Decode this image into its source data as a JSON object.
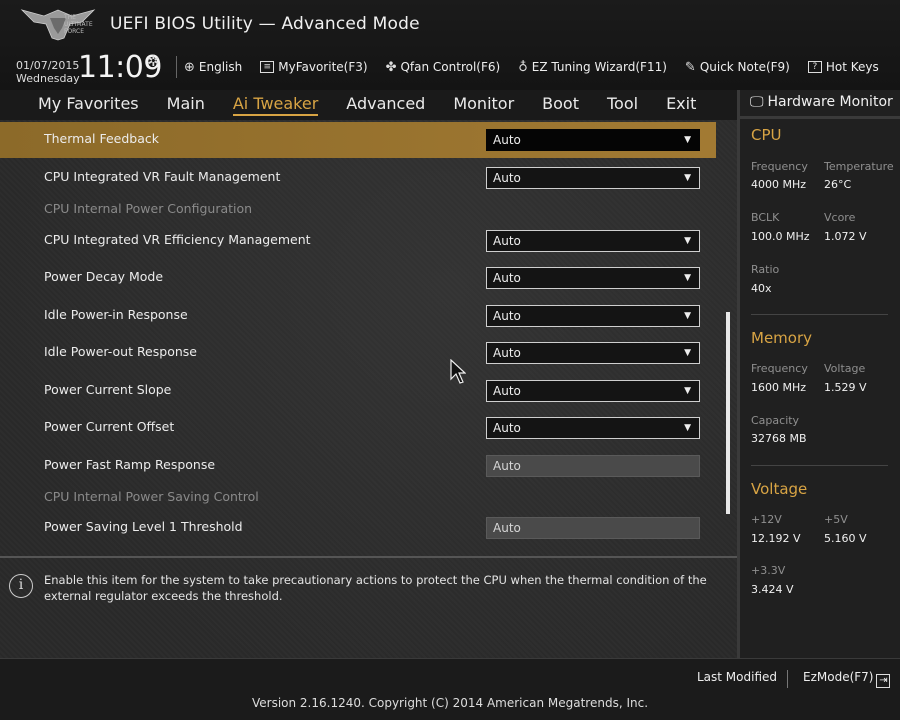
{
  "header": {
    "logo_text": "THE ULTIMATE FORCE",
    "title": "UEFI BIOS Utility — Advanced Mode",
    "date": "01/07/2015",
    "day": "Wednesday",
    "time": "11:09",
    "toolbar": [
      {
        "icon": "globe-icon",
        "label": "English"
      },
      {
        "icon": "myfavorite-icon",
        "label": "MyFavorite(F3)"
      },
      {
        "icon": "fan-icon",
        "label": "Qfan Control(F6)"
      },
      {
        "icon": "lightbulb-icon",
        "label": "EZ Tuning Wizard(F11)"
      },
      {
        "icon": "note-icon",
        "label": "Quick Note(F9)"
      },
      {
        "icon": "question-icon",
        "label": "Hot Keys"
      }
    ]
  },
  "menu": {
    "items": [
      "My Favorites",
      "Main",
      "Ai Tweaker",
      "Advanced",
      "Monitor",
      "Boot",
      "Tool",
      "Exit"
    ],
    "active": "Ai Tweaker"
  },
  "settings": [
    {
      "label": "Thermal Feedback",
      "value": "Auto",
      "type": "dropdown",
      "selected": true
    },
    {
      "label": "CPU Integrated VR Fault Management",
      "value": "Auto",
      "type": "dropdown"
    },
    {
      "label": "CPU Internal Power Configuration",
      "type": "section"
    },
    {
      "label": "CPU Integrated VR Efficiency Management",
      "value": "Auto",
      "type": "dropdown"
    },
    {
      "label": "Power Decay Mode",
      "value": "Auto",
      "type": "dropdown"
    },
    {
      "label": "Idle Power-in Response",
      "value": "Auto",
      "type": "dropdown"
    },
    {
      "label": "Idle Power-out Response",
      "value": "Auto",
      "type": "dropdown"
    },
    {
      "label": "Power Current Slope",
      "value": "Auto",
      "type": "dropdown"
    },
    {
      "label": "Power Current Offset",
      "value": "Auto",
      "type": "dropdown"
    },
    {
      "label": "Power Fast Ramp Response",
      "value": "Auto",
      "type": "input"
    },
    {
      "label": "CPU Internal Power Saving Control",
      "type": "section"
    },
    {
      "label": "Power Saving Level 1 Threshold",
      "value": "Auto",
      "type": "input"
    }
  ],
  "help_text": "Enable this item for the system to take precautionary actions to protect the CPU when the thermal condition of the external regulator exceeds the threshold.",
  "hardware_monitor": {
    "title": "Hardware Monitor",
    "cpu": {
      "heading": "CPU",
      "frequency_label": "Frequency",
      "frequency": "4000 MHz",
      "temperature_label": "Temperature",
      "temperature": "26°C",
      "bclk_label": "BCLK",
      "bclk": "100.0 MHz",
      "vcore_label": "Vcore",
      "vcore": "1.072 V",
      "ratio_label": "Ratio",
      "ratio": "40x"
    },
    "memory": {
      "heading": "Memory",
      "frequency_label": "Frequency",
      "frequency": "1600 MHz",
      "voltage_label": "Voltage",
      "voltage": "1.529 V",
      "capacity_label": "Capacity",
      "capacity": "32768 MB"
    },
    "voltage": {
      "heading": "Voltage",
      "v12_label": "+12V",
      "v12": "12.192 V",
      "v5_label": "+5V",
      "v5": "5.160 V",
      "v33_label": "+3.3V",
      "v33": "3.424 V"
    }
  },
  "footer": {
    "last_modified": "Last Modified",
    "ezmode": "EzMode(F7)",
    "version": "Version 2.16.1240. Copyright (C) 2014 American Megatrends, Inc."
  },
  "colors": {
    "accent": "#d8a444",
    "selected_row": "#9a7430"
  }
}
